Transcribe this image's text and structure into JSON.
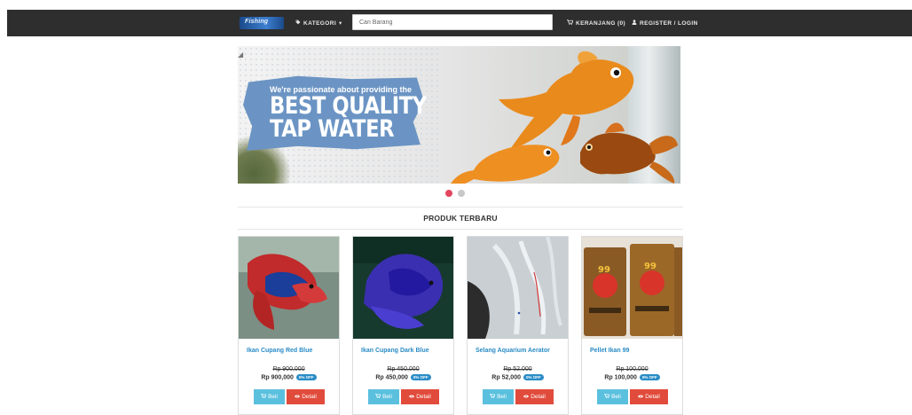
{
  "navbar": {
    "brand": "Fishing",
    "kategori_label": "KATEGORI",
    "kategori_icon": "tag-icon",
    "kategori_caret": "▾",
    "search_placeholder": "Cari Barang",
    "keranjang_label": "KERANJANG (0)",
    "keranjang_icon": "cart-icon",
    "register_label": "REGISTER / LOGIN",
    "register_icon": "user-icon"
  },
  "hero": {
    "line_small": "We're passionate about providing the",
    "line_big_1": "BEST QUALITY",
    "line_big_2": "TAP WATER",
    "slides": 2,
    "active_slide": 1
  },
  "section": {
    "title": "PRODUK TERBARU"
  },
  "products": [
    {
      "name": "Ikan Cupang Red Blue",
      "old_price": "Rp 900,000",
      "price": "Rp 900,000",
      "badge": "0% OFF",
      "beli_label": "Beli",
      "detail_label": "Detail"
    },
    {
      "name": "Ikan Cupang Dark Blue",
      "old_price": "Rp 450,000",
      "price": "Rp 450,000",
      "badge": "0% OFF",
      "beli_label": "Beli",
      "detail_label": "Detail"
    },
    {
      "name": "Selang Aquarium Aerator",
      "old_price": "Rp 52,000",
      "price": "Rp 52,000",
      "badge": "0% OFF",
      "beli_label": "Beli",
      "detail_label": "Detail"
    },
    {
      "name": "Pellet Ikan 99",
      "old_price": "Rp 100,000",
      "price": "Rp 100,000",
      "badge": "0% OFF",
      "beli_label": "Beli",
      "detail_label": "Detail"
    }
  ],
  "colors": {
    "navbar_bg": "#2e2e2e",
    "link_blue": "#2a8cc6",
    "beli_button": "#5bc0de",
    "detail_button": "#e14b3b",
    "indicator_active": "#e2465e"
  }
}
